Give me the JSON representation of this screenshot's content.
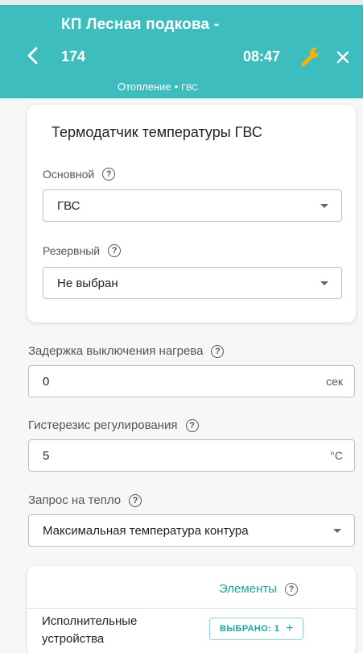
{
  "header": {
    "title": "КП Лесная подкова  -",
    "number": "174",
    "time": "08:47",
    "breadcrumb": {
      "section": "Отопление",
      "separator": "•",
      "current": "ГВС"
    },
    "background": "#3dbdbd",
    "icons": {
      "back": "chevron-left-icon",
      "settings": "wrench-icon",
      "close": "close-icon"
    }
  },
  "sensor_card": {
    "title": "Термодатчик температуры ГВС",
    "primary": {
      "label": "Основной",
      "value": "ГВС"
    },
    "reserve": {
      "label": "Резервный",
      "value": "Не выбран"
    }
  },
  "fields": {
    "delay": {
      "label": "Задержка выключения нагрева",
      "value": "0",
      "unit": "сек"
    },
    "hysteresis": {
      "label": "Гистерезис регулирования",
      "value": "5",
      "unit": "°C"
    },
    "heat_request": {
      "label": "Запрос на тепло",
      "value": "Максимальная температура контура"
    }
  },
  "help_glyph": "?",
  "elements_card": {
    "header": "Элементы",
    "row_label": "Исполнительные устройства",
    "chip_label": "ВЫБРАНО: 1",
    "chip_plus": "+",
    "accent": "#1aa3a3"
  }
}
